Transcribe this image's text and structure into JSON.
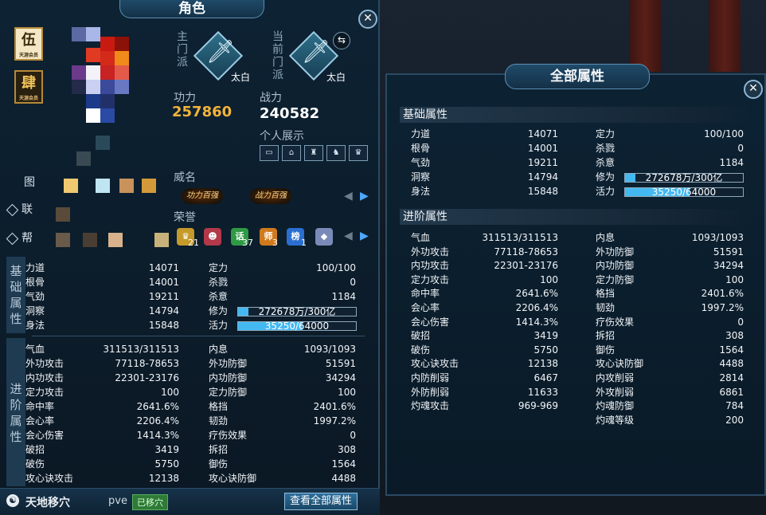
{
  "character_panel": {
    "title": "角色",
    "badges": [
      {
        "char": "伍",
        "sub": "天涯会员"
      },
      {
        "char": "肆",
        "sub": "天涯会员"
      }
    ],
    "side_tabs": [
      "图",
      "联",
      "帮"
    ],
    "sect": {
      "main_label": "主门派",
      "main_name": "太白",
      "current_label": "当前门派",
      "current_name": "太白"
    },
    "gongli_label": "功力",
    "gongli_value": "257860",
    "zhanli_label": "战力",
    "zhanli_value": "240582",
    "personal_show_label": "个人展示",
    "personal_icons": [
      "id-card-icon",
      "house-icon",
      "castle-icon",
      "mount-icon",
      "trophy-icon"
    ],
    "weiming_label": "威名",
    "titles": [
      "功力百强",
      "战力百强"
    ],
    "rongyu_label": "荣誉",
    "honors": [
      {
        "icon": "crown-icon",
        "count": "21",
        "color": "#c49a2a"
      },
      {
        "icon": "mask-icon",
        "count": "",
        "color": "#b2384a"
      },
      {
        "icon": "scroll-icon",
        "count": "37",
        "color": "#2f9a45",
        "char": "话"
      },
      {
        "icon": "master-icon",
        "count": "3",
        "color": "#d07a1c",
        "char": "师"
      },
      {
        "icon": "rank-icon",
        "count": "1",
        "color": "#2a6fd0",
        "char": "榜"
      },
      {
        "icon": "gem-icon",
        "count": "",
        "color": "#7a8ab8"
      }
    ],
    "basic_section_label": "基础属性",
    "advanced_section_label": "进阶属性",
    "bottom": {
      "location": "天地移穴",
      "mode": "pve",
      "status": "已移穴",
      "view_all_button": "查看全部属性"
    }
  },
  "attributes": {
    "basic_left": [
      {
        "name": "力道",
        "value": "14071"
      },
      {
        "name": "根骨",
        "value": "14001"
      },
      {
        "name": "气劲",
        "value": "19211"
      },
      {
        "name": "洞察",
        "value": "14794"
      },
      {
        "name": "身法",
        "value": "15848"
      }
    ],
    "basic_right": [
      {
        "name": "定力",
        "value": "100/100"
      },
      {
        "name": "杀戮",
        "value": "0"
      },
      {
        "name": "杀意",
        "value": "1184"
      }
    ],
    "xiuwei": {
      "name": "修为",
      "text": "272678万/300亿",
      "fraction": 0.09
    },
    "huoli": {
      "name": "活力",
      "text": "35250/64000",
      "fraction": 0.55
    },
    "advanced_left": [
      {
        "name": "气血",
        "value": "311513/311513"
      },
      {
        "name": "外功攻击",
        "value": "77118-78653"
      },
      {
        "name": "内功攻击",
        "value": "22301-23176"
      },
      {
        "name": "定力攻击",
        "value": "100"
      },
      {
        "name": "命中率",
        "value": "2641.6%"
      },
      {
        "name": "会心率",
        "value": "2206.4%"
      },
      {
        "name": "会心伤害",
        "value": "1414.3%"
      },
      {
        "name": "破招",
        "value": "3419"
      },
      {
        "name": "破伤",
        "value": "5750"
      },
      {
        "name": "攻心诀攻击",
        "value": "12138"
      },
      {
        "name": "内防削弱",
        "value": "6467"
      },
      {
        "name": "外防削弱",
        "value": "11633"
      },
      {
        "name": "灼魂攻击",
        "value": "969-969"
      }
    ],
    "advanced_right": [
      {
        "name": "内息",
        "value": "1093/1093"
      },
      {
        "name": "外功防御",
        "value": "51591"
      },
      {
        "name": "内功防御",
        "value": "34294"
      },
      {
        "name": "定力防御",
        "value": "100"
      },
      {
        "name": "格挡",
        "value": "2401.6%"
      },
      {
        "name": "韧劲",
        "value": "1997.2%"
      },
      {
        "name": "疗伤效果",
        "value": "0"
      },
      {
        "name": "拆招",
        "value": "308"
      },
      {
        "name": "御伤",
        "value": "1564"
      },
      {
        "name": "攻心诀防御",
        "value": "4488"
      },
      {
        "name": "内攻削弱",
        "value": "2814"
      },
      {
        "name": "外攻削弱",
        "value": "6861"
      },
      {
        "name": "灼魂防御",
        "value": "784"
      },
      {
        "name": "灼魂等级",
        "value": "200"
      }
    ]
  },
  "all_attributes_panel": {
    "title": "全部属性",
    "basic_header": "基础属性",
    "advanced_header": "进阶属性"
  }
}
